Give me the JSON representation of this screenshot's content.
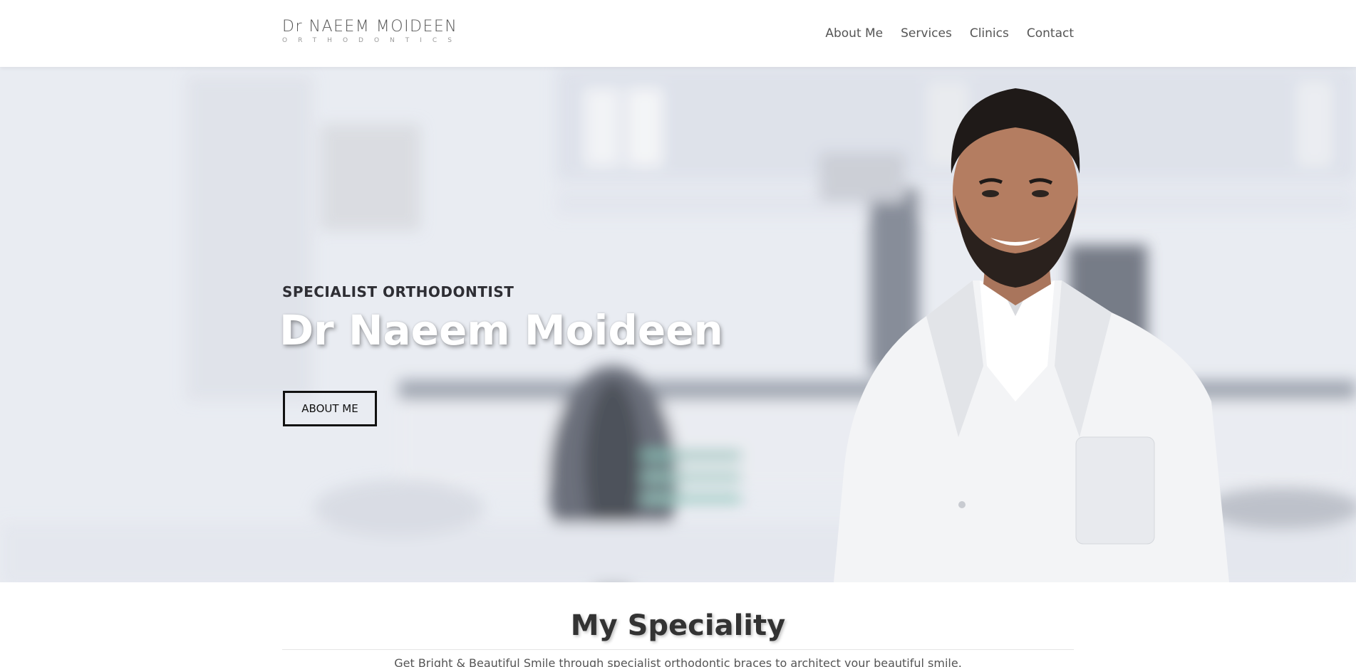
{
  "header": {
    "logo": {
      "main_prefix": "Dr",
      "main_name": " NAEEM MOIDEEN",
      "sub": "ORTHODONTICS"
    },
    "nav": [
      "About Me",
      "Services",
      "Clinics",
      "Contact"
    ]
  },
  "hero": {
    "eyebrow": "SPECIALIST ORTHODONTIST",
    "title": "Dr Naeem Moideen",
    "button_label": "ABOUT ME"
  },
  "speciality": {
    "title": "My Speciality",
    "text": "Get Bright & Beautiful Smile through specialist orthodontic braces to architect your beautiful smile."
  },
  "colors": {
    "hero_bg": "#e6e9f0",
    "text_dark": "#2e2e34",
    "button_border": "#111111"
  }
}
